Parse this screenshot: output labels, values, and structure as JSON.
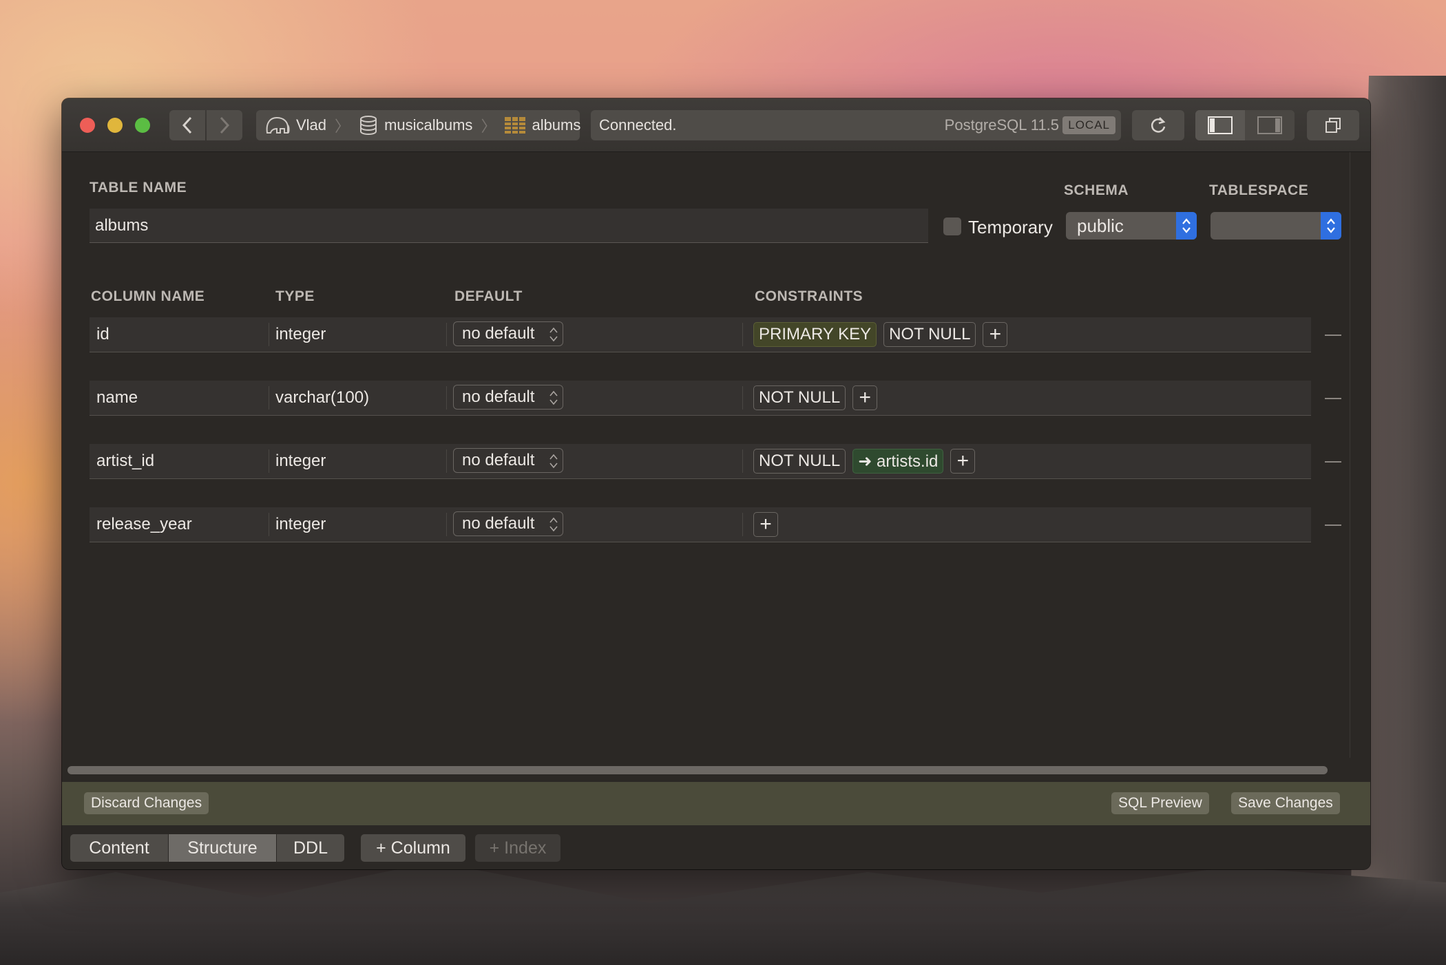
{
  "window": {
    "breadcrumb": [
      {
        "label": "Vlad",
        "icon": "elephant-icon"
      },
      {
        "label": "musicalbums",
        "icon": "database-icon"
      },
      {
        "label": "albums",
        "icon": "table-icon"
      }
    ],
    "status": "Connected.",
    "server": "PostgreSQL 11.5",
    "server_badge": "LOCAL"
  },
  "form": {
    "table_name_label": "TABLE NAME",
    "table_name_value": "albums",
    "temporary_label": "Temporary",
    "schema_label": "SCHEMA",
    "schema_value": "public",
    "tablespace_label": "TABLESPACE",
    "tablespace_value": ""
  },
  "columns_header": {
    "name": "COLUMN NAME",
    "type": "TYPE",
    "default": "DEFAULT",
    "constraints": "CONSTRAINTS"
  },
  "rows": [
    {
      "name": "id",
      "type": "integer",
      "default": "no default",
      "constraints": [
        "PRIMARY KEY",
        "NOT NULL"
      ]
    },
    {
      "name": "name",
      "type": "varchar(100)",
      "default": "no default",
      "constraints": [
        "NOT NULL"
      ]
    },
    {
      "name": "artist_id",
      "type": "integer",
      "default": "no default",
      "constraints": [
        "NOT NULL",
        "➜ artists.id"
      ]
    },
    {
      "name": "release_year",
      "type": "integer",
      "default": "no default",
      "constraints": []
    }
  ],
  "actions": {
    "discard": "Discard Changes",
    "sql_preview": "SQL Preview",
    "save": "Save Changes"
  },
  "footer": {
    "tabs": [
      "Content",
      "Structure",
      "DDL"
    ],
    "active_tab": "Structure",
    "add_column": "+ Column",
    "add_index": "+ Index"
  },
  "colors": {
    "primary_key_tag": "#434628",
    "foreign_key_tag": "#2f4a2f",
    "select_accent": "#2f6fe0"
  }
}
